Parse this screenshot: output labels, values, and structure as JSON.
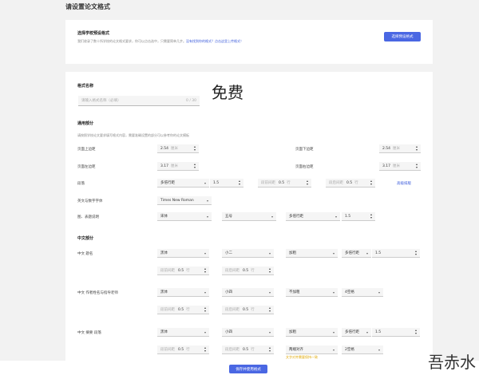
{
  "page_title": "请设置论文格式",
  "preset": {
    "title": "选择学校预设格式",
    "desc": "我们收录了数十所学校的论文格式要求，你可以点击选中，只需要简单几步。",
    "link": "没有找到你的格式？点击这里上传格式！",
    "button": "选择预设格式"
  },
  "name_section": {
    "title": "格式名称",
    "placeholder": "请输入格式名称（必填）",
    "counter": "0 / 30"
  },
  "watermark": "免费",
  "general": {
    "title": "通用部分",
    "desc": "请按照学校论文要求填写格式内容，需要准确设置的部分可以参考你的论文模板",
    "advanced_link": "高级排版"
  },
  "rows": [
    {
      "label": "页面上边距",
      "controls": [
        {
          "type": "stepper",
          "value": "2.54",
          "unit": "厘米"
        }
      ]
    },
    {
      "label": "页面下边距",
      "controls": [
        {
          "type": "stepper",
          "value": "2.54",
          "unit": "厘米"
        }
      ]
    },
    {
      "label": "页面左边距",
      "controls": [
        {
          "type": "stepper",
          "value": "3.17",
          "unit": "厘米"
        }
      ]
    },
    {
      "label": "页面右边距",
      "controls": [
        {
          "type": "stepper",
          "value": "3.17",
          "unit": "厘米"
        }
      ]
    },
    {
      "label": "段落",
      "controls": [
        {
          "type": "select",
          "value": "多倍行距"
        },
        {
          "type": "stepper",
          "value": "1.5"
        },
        {
          "type": "stepper",
          "prefix": "段前间距",
          "value": "0.5",
          "unit": "行"
        },
        {
          "type": "stepper",
          "prefix": "段后间距",
          "value": "0.5",
          "unit": "行"
        }
      ]
    },
    {
      "label": "英文与数字字体",
      "controls": [
        {
          "type": "select",
          "value": "Times New Roman"
        }
      ]
    },
    {
      "label": "图、表题说明",
      "controls": [
        {
          "type": "select",
          "value": "宋体"
        },
        {
          "type": "select",
          "value": "五号"
        },
        {
          "type": "select",
          "value": "多倍行距"
        },
        {
          "type": "stepper",
          "value": "1.5"
        }
      ]
    }
  ],
  "chinese": {
    "title": "中文部分",
    "rows": [
      {
        "label": "中文 题名",
        "controls": [
          {
            "type": "select",
            "value": "黑体"
          },
          {
            "type": "select",
            "value": "小二"
          },
          {
            "type": "select",
            "value": "加粗"
          },
          {
            "type": "select",
            "value": "多倍行距"
          },
          {
            "type": "stepper",
            "value": "1.5"
          }
        ]
      },
      {
        "label": "",
        "controls": [
          {
            "type": "stepper",
            "prefix": "段前间距",
            "value": "0.5",
            "unit": "行"
          },
          {
            "type": "stepper",
            "prefix": "段后间距",
            "value": "0.5",
            "unit": "行"
          }
        ]
      },
      {
        "label": "中文 作者姓名与指导老师",
        "controls": [
          {
            "type": "select",
            "value": "黑体"
          },
          {
            "type": "select",
            "value": "小四"
          },
          {
            "type": "select",
            "value": "不加粗"
          },
          {
            "type": "select",
            "value": "4空格"
          }
        ]
      },
      {
        "label": "",
        "controls": [
          {
            "type": "stepper",
            "prefix": "段前间距",
            "value": "0.5",
            "unit": "行"
          },
          {
            "type": "stepper",
            "prefix": "段后间距",
            "value": "0.5",
            "unit": "行"
          }
        ]
      },
      {
        "label": "中文 摘要 段落",
        "controls": [
          {
            "type": "select",
            "value": "黑体"
          },
          {
            "type": "select",
            "value": "小四"
          },
          {
            "type": "select",
            "value": "加粗"
          },
          {
            "type": "select",
            "value": "多倍行距"
          },
          {
            "type": "stepper",
            "value": "1.5"
          }
        ]
      },
      {
        "label": "",
        "controls": [
          {
            "type": "stepper",
            "prefix": "段前间距",
            "value": "0.5",
            "unit": "行"
          },
          {
            "type": "stepper",
            "prefix": "段后间距",
            "value": "0.5",
            "unit": "行"
          },
          {
            "type": "select",
            "value": "两端对齐"
          },
          {
            "type": "select",
            "value": "2空格"
          }
        ]
      }
    ],
    "warning": "文字对齐需要保持一致"
  },
  "footer": {
    "save_button": "保存并使用格式"
  },
  "logo_text": "吾赤水网"
}
